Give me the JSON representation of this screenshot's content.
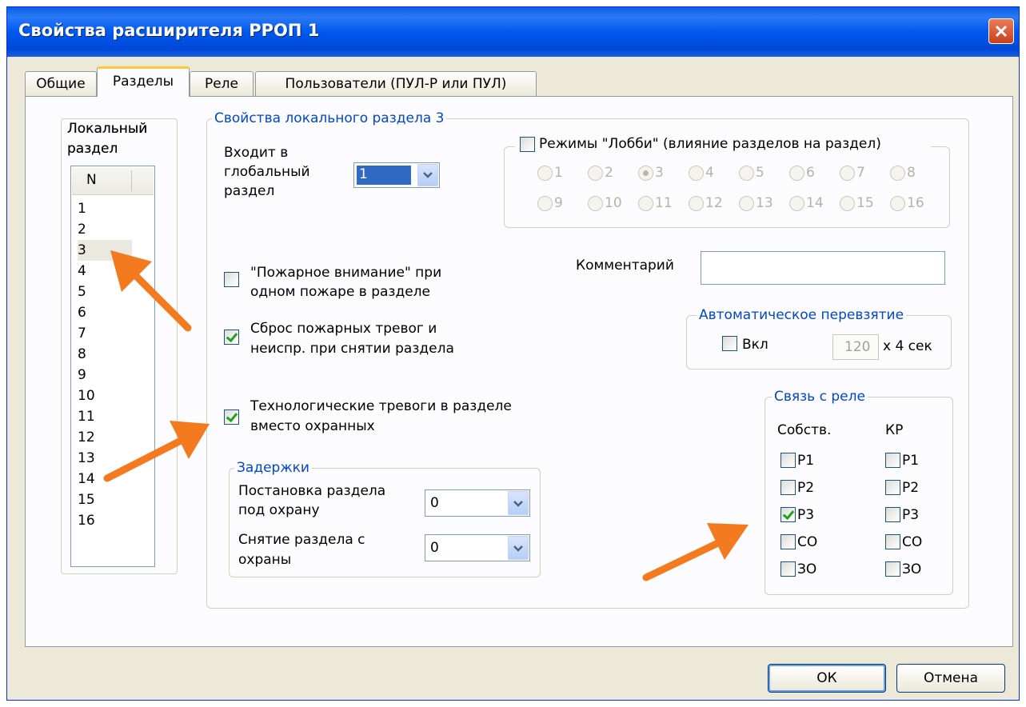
{
  "window": {
    "title": "Свойства расширителя РРОП 1"
  },
  "tabs": [
    "Общие",
    "Разделы",
    "Реле",
    "Пользователи (ПУЛ-Р или ПУЛ)"
  ],
  "active_tab": 1,
  "local_section": {
    "label_line1": "Локальный",
    "label_line2": "раздел",
    "column_header": "N",
    "items": [
      "1",
      "2",
      "3",
      "4",
      "5",
      "6",
      "7",
      "8",
      "9",
      "10",
      "11",
      "12",
      "13",
      "14",
      "15",
      "16"
    ],
    "selected_index": 2
  },
  "section_props": {
    "legend": "Свойства локального раздела 3",
    "global_label_line1": "Входит в",
    "global_label_line2": "глобальный",
    "global_label_line3": "раздел",
    "global_value": "1",
    "lobby": {
      "label": "Режимы \"Лобби\" (влияние разделов на раздел)",
      "checked": false,
      "radios": [
        "1",
        "2",
        "3",
        "4",
        "5",
        "6",
        "7",
        "8",
        "9",
        "10",
        "11",
        "12",
        "13",
        "14",
        "15",
        "16"
      ],
      "selected": "3"
    },
    "fire_attention": {
      "line1": "\"Пожарное внимание\" при",
      "line2": "одном пожаре  в разделе",
      "checked": false
    },
    "reset_alarms": {
      "line1": "Сброс пожарных тревог и",
      "line2": "неиспр. при снятии раздела",
      "checked": true
    },
    "tech_alarms": {
      "line1": "Технологические тревоги в разделе",
      "line2": "вместо охранных",
      "checked": true
    },
    "comment_label": "Комментарий",
    "comment_value": "",
    "auto_rearm": {
      "legend": "Автоматическое перевзятие",
      "enable_label": "Вкл",
      "enabled": false,
      "value": "120",
      "unit": "x 4 сек"
    },
    "delays": {
      "legend": "Задержки",
      "arm_line1": "Постановка раздела",
      "arm_line2": "под охрану",
      "arm_value": "0",
      "disarm_line1": "Снятие раздела с",
      "disarm_line2": "охраны",
      "disarm_value": "0"
    },
    "relay_link": {
      "legend": "Связь с реле",
      "own_header": "Собств.",
      "kr_header": "КР",
      "own": [
        {
          "label": "Р1",
          "checked": false
        },
        {
          "label": "Р2",
          "checked": false
        },
        {
          "label": "Р3",
          "checked": true
        },
        {
          "label": "СО",
          "checked": false
        },
        {
          "label": "ЗО",
          "checked": false
        }
      ],
      "kr": [
        {
          "label": "Р1",
          "checked": false
        },
        {
          "label": "Р2",
          "checked": false
        },
        {
          "label": "Р3",
          "checked": false
        },
        {
          "label": "СО",
          "checked": false
        },
        {
          "label": "ЗО",
          "checked": false
        }
      ]
    }
  },
  "buttons": {
    "ok": "ОК",
    "cancel": "Отмена"
  },
  "colors": {
    "titlebar": "#0058ee",
    "accent_arrow": "#f47a20",
    "legend_text": "#0046d5"
  }
}
